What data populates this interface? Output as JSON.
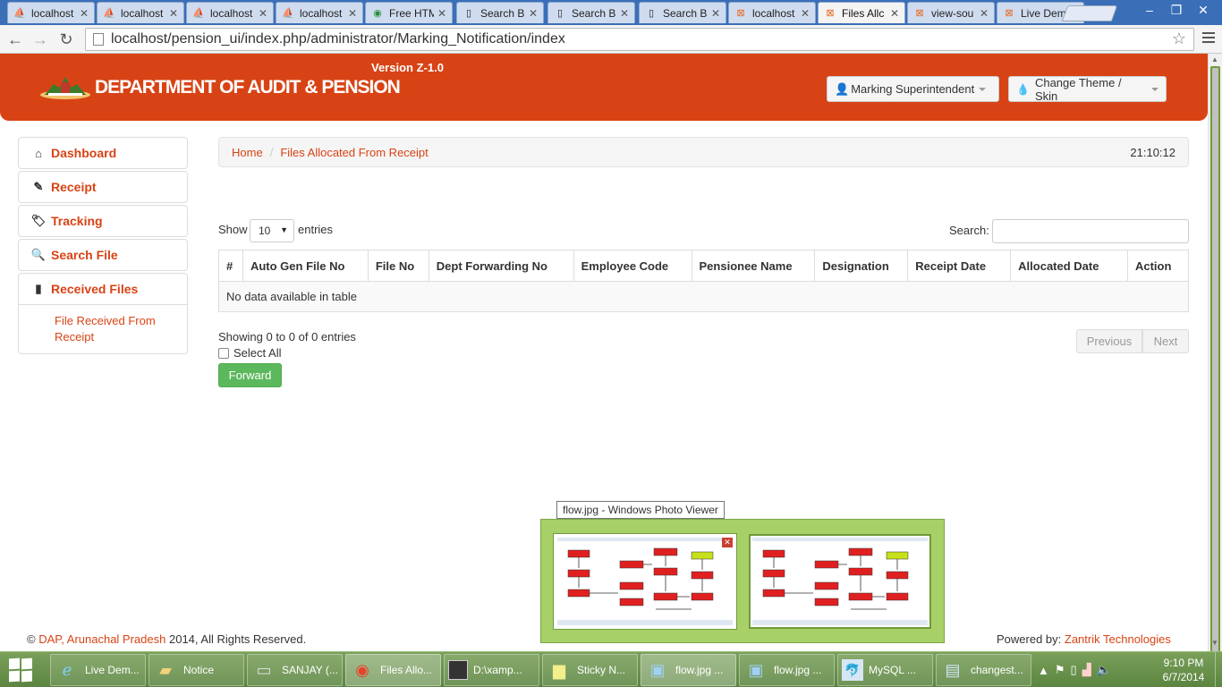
{
  "browser": {
    "tabs": [
      {
        "label": "localhost",
        "icon": "pma-icon"
      },
      {
        "label": "localhost",
        "icon": "pma-icon"
      },
      {
        "label": "localhost",
        "icon": "pma-icon"
      },
      {
        "label": "localhost",
        "icon": "pma-icon"
      },
      {
        "label": "Free HTM",
        "icon": "chrome-icon"
      },
      {
        "label": "Search B",
        "icon": "page-icon"
      },
      {
        "label": "Search B",
        "icon": "page-icon"
      },
      {
        "label": "Search B",
        "icon": "page-icon"
      },
      {
        "label": "localhost",
        "icon": "xampp-icon"
      },
      {
        "label": "Files Allc",
        "icon": "xampp-icon",
        "active": true
      },
      {
        "label": "view-sou",
        "icon": "xampp-icon"
      },
      {
        "label": "Live Dem",
        "icon": "xampp-icon"
      }
    ],
    "url": "localhost/pension_ui/index.php/administrator/Marking_Notification/index"
  },
  "header": {
    "brand": "DEPARTMENT OF AUDIT & PENSION",
    "version": "Version Z-1.0",
    "user_button": "Marking Superintendent",
    "theme_button": "Change Theme / Skin",
    "color": "#d84315"
  },
  "sidebar": {
    "items": [
      {
        "label": "Dashboard",
        "icon": "home-icon"
      },
      {
        "label": "Receipt",
        "icon": "pencil-icon"
      },
      {
        "label": "Tracking",
        "icon": "tags-icon"
      },
      {
        "label": "Search File",
        "icon": "search-icon"
      },
      {
        "label": "Received Files",
        "icon": "file-icon"
      }
    ],
    "sub_item": "File Received From Receipt"
  },
  "breadcrumb": {
    "home": "Home",
    "current": "Files Allocated From Receipt",
    "clock": "21:10:12"
  },
  "table": {
    "show_label": "Show",
    "entries_label": "entries",
    "length_value": "10",
    "search_label": "Search:",
    "search_value": "",
    "columns": [
      "#",
      "Auto Gen File No",
      "File No",
      "Dept Forwarding No",
      "Employee Code",
      "Pensionee Name",
      "Designation",
      "Receipt Date",
      "Allocated Date",
      "Action"
    ],
    "empty_message": "No data available in table",
    "info": "Showing 0 to 0 of 0 entries",
    "prev": "Previous",
    "next": "Next"
  },
  "select_all": "Select All",
  "forward_button": "Forward",
  "footer": {
    "copyright_symbol": "©",
    "org": "DAP, Arunachal Pradesh",
    "rights": "2014, All Rights Reserved.",
    "powered_label": "Powered by:",
    "powered_by": "Zantrik Technologies"
  },
  "preview": {
    "tooltip": "flow.jpg - Windows Photo Viewer"
  },
  "taskbar": {
    "items": [
      {
        "label": "Live Dem...",
        "icon": "ie-icon"
      },
      {
        "label": "Notice",
        "icon": "folder-icon"
      },
      {
        "label": "SANJAY (...",
        "icon": "drive-icon"
      },
      {
        "label": "Files Allo...",
        "icon": "chrome-icon"
      },
      {
        "label": "D:\\xamp...",
        "icon": "cmd-icon"
      },
      {
        "label": "Sticky N...",
        "icon": "sticky-notes-icon"
      },
      {
        "label": "flow.jpg ...",
        "icon": "photo-viewer-icon",
        "active": true
      },
      {
        "label": "flow.jpg ...",
        "icon": "photo-viewer-icon"
      },
      {
        "label": "MySQL ...",
        "icon": "mysql-icon"
      },
      {
        "label": "changest...",
        "icon": "notepad-icon"
      }
    ],
    "time": "9:10 PM",
    "date": "6/7/2014"
  }
}
